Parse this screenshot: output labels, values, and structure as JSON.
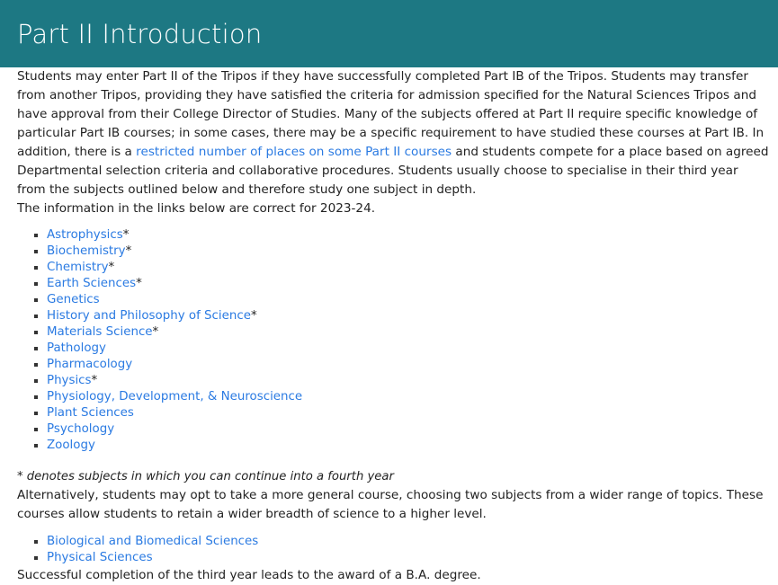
{
  "header": {
    "title": "Part II Introduction",
    "background_color": "#1d7883",
    "text_color": "#ffffff"
  },
  "theme": {
    "link_color": "#2a7ae2",
    "body_text_color": "#222222",
    "page_background": "#ffffff"
  },
  "paragraphs": {
    "intro_part_1": "Students may enter Part II of the Tripos if they have successfully completed Part IB of the Tripos. Students may transfer from another Tripos, providing they have satisfied the criteria for admission specified for the Natural Sciences Tripos and have approval from their College Director of Studies. Many of the subjects offered at Part II require specific knowledge of particular Part IB courses; in some cases, there may be a specific requirement to have studied these courses at Part IB. In addition, there is a ",
    "intro_link_text": "restricted number of places on some Part II courses",
    "intro_part_2": " and students compete for a place based on agreed Departmental selection criteria and collaborative procedures. Students usually choose to specialise in their third year from the subjects outlined below and therefore study one subject in depth.",
    "links_validity": "The information in the links below are correct for 2023-24.",
    "fourth_year_note": "* denotes subjects in which you can continue into a fourth year",
    "general_course": "Alternatively, students may opt to take a more general course, choosing two subjects from a wider range of topics. These courses allow students to retain a wider breadth of science to a higher level.",
    "degree_outcome": "Successful completion of the third year leads to the award of a B.A. degree."
  },
  "subject_list": [
    {
      "label": "Astrophysics",
      "star": "*"
    },
    {
      "label": "Biochemistry",
      "star": "*"
    },
    {
      "label": "Chemistry",
      "star": "*"
    },
    {
      "label": "Earth Sciences",
      "star": "*"
    },
    {
      "label": "Genetics",
      "star": ""
    },
    {
      "label": "History and Philosophy of Science",
      "star": "*"
    },
    {
      "label": "Materials Science",
      "star": "*"
    },
    {
      "label": "Pathology",
      "star": ""
    },
    {
      "label": "Pharmacology",
      "star": ""
    },
    {
      "label": "Physics",
      "star": "*"
    },
    {
      "label": "Physiology, Development, & Neuroscience",
      "star": ""
    },
    {
      "label": "Plant Sciences",
      "star": ""
    },
    {
      "label": "Psychology",
      "star": ""
    },
    {
      "label": "Zoology",
      "star": ""
    }
  ],
  "general_course_list": [
    {
      "label": "Biological and Biomedical Sciences",
      "star": ""
    },
    {
      "label": "Physical Sciences",
      "star": ""
    }
  ]
}
